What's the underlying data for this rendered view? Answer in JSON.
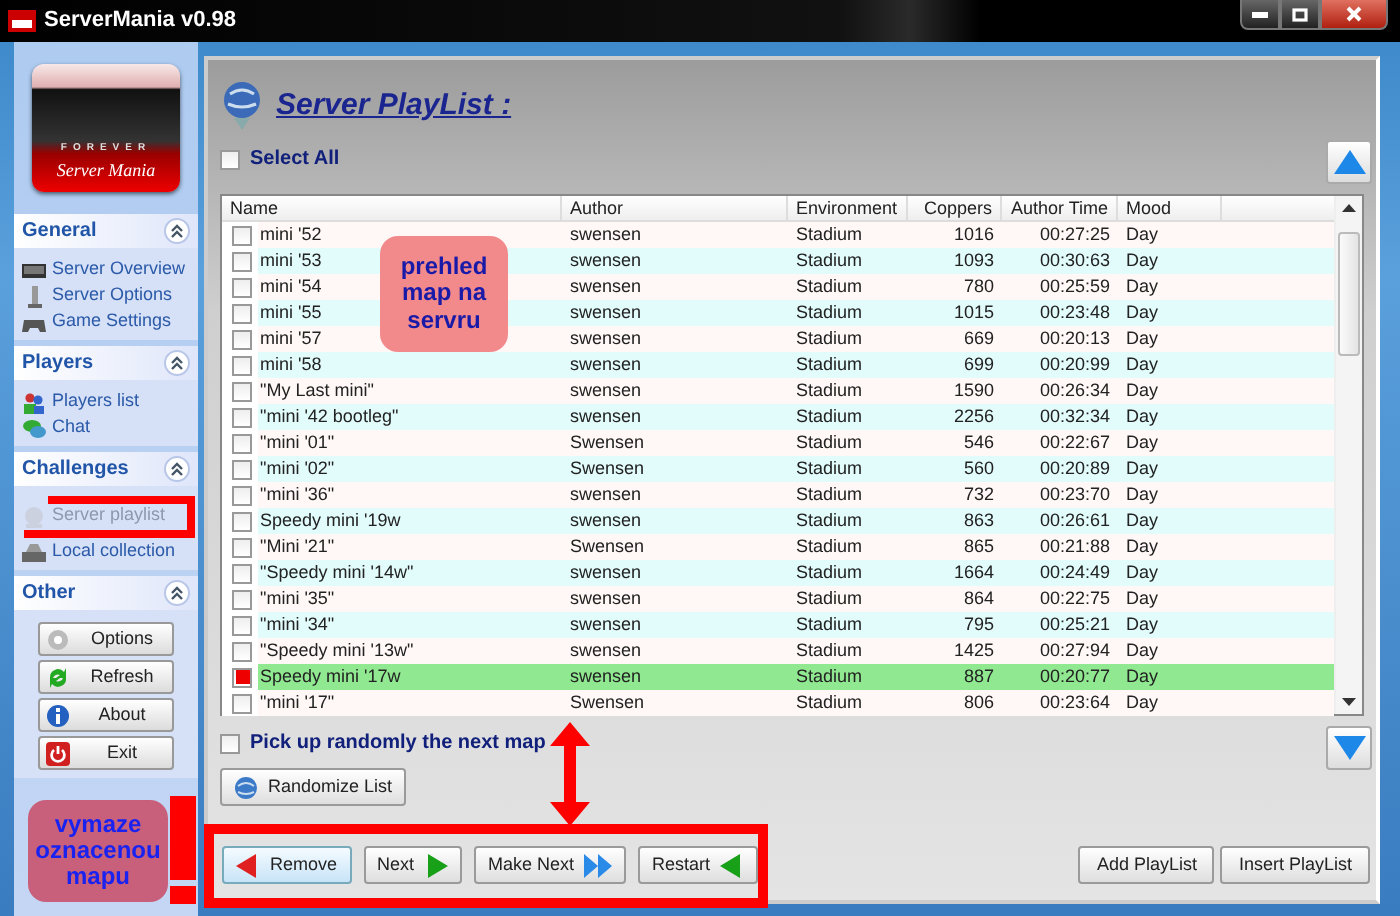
{
  "window": {
    "title": "ServerMania v0.98"
  },
  "sidebar": {
    "logo": {
      "subtitle": "FOREVER",
      "name": "Server Mania"
    },
    "sections": [
      {
        "title": "General",
        "expanded": true,
        "items": [
          {
            "label": "Server Overview",
            "disabled": false
          },
          {
            "label": "Server Options",
            "disabled": false
          },
          {
            "label": "Game Settings",
            "disabled": false
          }
        ]
      },
      {
        "title": "Players",
        "expanded": true,
        "items": [
          {
            "label": "Players list",
            "disabled": false
          },
          {
            "label": "Chat",
            "disabled": false
          }
        ]
      },
      {
        "title": "Challenges",
        "expanded": true,
        "items": [
          {
            "label": "Server playlist",
            "disabled": true
          },
          {
            "label": "Local collection",
            "disabled": false
          }
        ]
      },
      {
        "title": "Other",
        "expanded": true,
        "buttons": [
          "Options",
          "Refresh",
          "About",
          "Exit"
        ]
      }
    ]
  },
  "main": {
    "title": "Server PlayList :",
    "select_all": {
      "label": "Select All",
      "checked": false
    },
    "table": {
      "columns": [
        "Name",
        "Author",
        "Environment",
        "Coppers",
        "Author Time",
        "Mood"
      ],
      "rows": [
        {
          "cells": [
            "mini '52",
            "swensen",
            "Stadium",
            "1016",
            "00:27:25",
            "Day"
          ],
          "checked": false,
          "selected": false
        },
        {
          "cells": [
            "mini '53",
            "swensen",
            "Stadium",
            "1093",
            "00:30:63",
            "Day"
          ],
          "checked": false,
          "selected": false
        },
        {
          "cells": [
            "mini '54",
            "swensen",
            "Stadium",
            "780",
            "00:25:59",
            "Day"
          ],
          "checked": false,
          "selected": false
        },
        {
          "cells": [
            "mini '55",
            "swensen",
            "Stadium",
            "1015",
            "00:23:48",
            "Day"
          ],
          "checked": false,
          "selected": false
        },
        {
          "cells": [
            "mini '57",
            "swensen",
            "Stadium",
            "669",
            "00:20:13",
            "Day"
          ],
          "checked": false,
          "selected": false
        },
        {
          "cells": [
            "mini '58",
            "swensen",
            "Stadium",
            "699",
            "00:20:99",
            "Day"
          ],
          "checked": false,
          "selected": false
        },
        {
          "cells": [
            "\"My Last mini\"",
            "swensen",
            "Stadium",
            "1590",
            "00:26:34",
            "Day"
          ],
          "checked": false,
          "selected": false
        },
        {
          "cells": [
            "\"mini '42 bootleg\"",
            "swensen",
            "Stadium",
            "2256",
            "00:32:34",
            "Day"
          ],
          "checked": false,
          "selected": false
        },
        {
          "cells": [
            "\"mini '01\"",
            "Swensen",
            "Stadium",
            "546",
            "00:22:67",
            "Day"
          ],
          "checked": false,
          "selected": false
        },
        {
          "cells": [
            "\"mini '02\"",
            "Swensen",
            "Stadium",
            "560",
            "00:20:89",
            "Day"
          ],
          "checked": false,
          "selected": false
        },
        {
          "cells": [
            "\"mini '36\"",
            "swensen",
            "Stadium",
            "732",
            "00:23:70",
            "Day"
          ],
          "checked": false,
          "selected": false
        },
        {
          "cells": [
            "Speedy mini '19w",
            "swensen",
            "Stadium",
            "863",
            "00:26:61",
            "Day"
          ],
          "checked": false,
          "selected": false
        },
        {
          "cells": [
            "\"Mini '21\"",
            "Swensen",
            "Stadium",
            "865",
            "00:21:88",
            "Day"
          ],
          "checked": false,
          "selected": false
        },
        {
          "cells": [
            "\"Speedy mini '14w\"",
            "swensen",
            "Stadium",
            "1664",
            "00:24:49",
            "Day"
          ],
          "checked": false,
          "selected": false
        },
        {
          "cells": [
            "\"mini '35\"",
            "swensen",
            "Stadium",
            "864",
            "00:22:75",
            "Day"
          ],
          "checked": false,
          "selected": false
        },
        {
          "cells": [
            "\"mini '34\"",
            "swensen",
            "Stadium",
            "795",
            "00:25:21",
            "Day"
          ],
          "checked": false,
          "selected": false
        },
        {
          "cells": [
            "\"Speedy mini '13w\"",
            "swensen",
            "Stadium",
            "1425",
            "00:27:94",
            "Day"
          ],
          "checked": false,
          "selected": false
        },
        {
          "cells": [
            "Speedy mini '17w",
            "swensen",
            "Stadium",
            "887",
            "00:20:77",
            "Day"
          ],
          "checked": true,
          "selected": true
        },
        {
          "cells": [
            "\"mini '17\"",
            "Swensen",
            "Stadium",
            "806",
            "00:23:64",
            "Day"
          ],
          "checked": false,
          "selected": false
        }
      ]
    },
    "random_pick": {
      "label": "Pick up randomly the next map",
      "checked": false
    },
    "randomize_button": "Randomize List",
    "action_buttons": [
      "Remove",
      "Next",
      "Make Next",
      "Restart"
    ],
    "playlist_buttons": [
      "Add PlayList",
      "Insert PlayList"
    ]
  },
  "annotations": [
    {
      "kind": "callout",
      "text": "prehled map na servru"
    },
    {
      "kind": "bracket"
    },
    {
      "kind": "double_arrow"
    },
    {
      "kind": "frame"
    },
    {
      "kind": "exclamation"
    },
    {
      "kind": "callout",
      "text": "vymaze oznacenou mapu"
    }
  ]
}
